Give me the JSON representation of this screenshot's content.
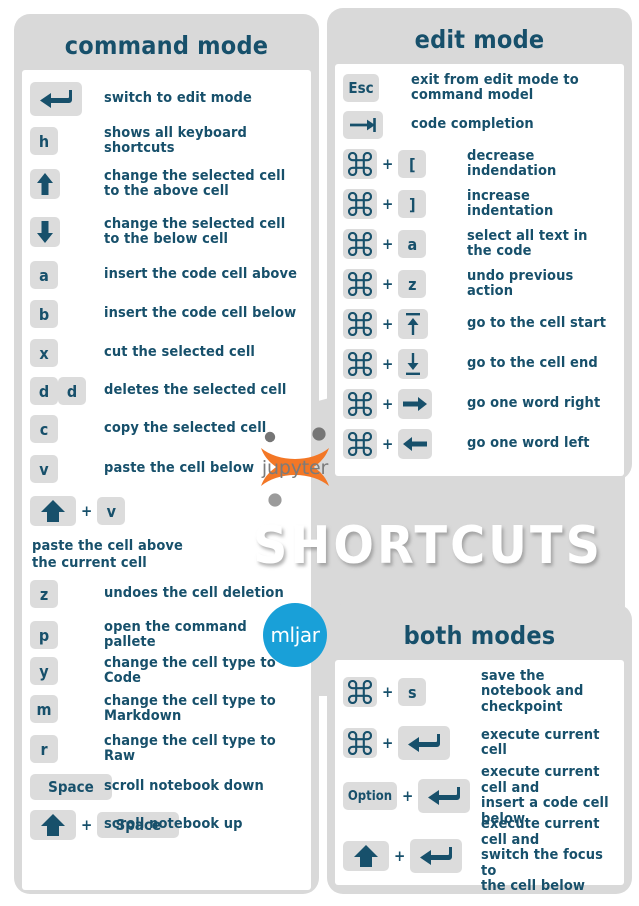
{
  "colors": {
    "panel_gray": "#d9d9d9",
    "key_gray": "#dcdcdc",
    "ink": "#17506b",
    "jupyter_orange": "#f37726",
    "jupyter_gray": "#7b7b7b",
    "mljar_blue": "#19a0d8",
    "white": "#ffffff"
  },
  "wordmark": {
    "text": "SHORTCUTS"
  },
  "logos": {
    "jupyter": {
      "name": "jupyter-logo",
      "label": "jupyter"
    },
    "mljar": {
      "name": "mljar-logo",
      "label": "mljar"
    }
  },
  "panels": {
    "command": {
      "title": "command mode",
      "rows": [
        {
          "keys": [
            {
              "type": "enter",
              "label": "↵",
              "icon": "enter-key-icon"
            }
          ],
          "desc": "switch to edit mode"
        },
        {
          "keys": [
            {
              "type": "char",
              "label": "h"
            }
          ],
          "desc": "shows all keyboard shortcuts"
        },
        {
          "keys": [
            {
              "type": "arrow-up-solid",
              "label": "⬆",
              "icon": "arrow-up-icon"
            }
          ],
          "desc": "change the selected cell to the above cell"
        },
        {
          "keys": [
            {
              "type": "arrow-down-solid",
              "label": "⬇",
              "icon": "arrow-down-icon"
            }
          ],
          "desc": "change the selected cell to the below cell"
        },
        {
          "keys": [
            {
              "type": "char",
              "label": "a"
            }
          ],
          "desc": "insert the code cell above"
        },
        {
          "keys": [
            {
              "type": "char",
              "label": "b"
            }
          ],
          "desc": "insert the code cell below"
        },
        {
          "keys": [
            {
              "type": "char",
              "label": "x"
            }
          ],
          "desc": "cut the selected cell"
        },
        {
          "keys": [
            {
              "type": "char",
              "label": "d"
            },
            {
              "type": "char",
              "label": "d"
            }
          ],
          "desc": "deletes the selected cell"
        },
        {
          "keys": [
            {
              "type": "char",
              "label": "c"
            }
          ],
          "desc": "copy the selected cell"
        },
        {
          "keys": [
            {
              "type": "char",
              "label": "v"
            }
          ],
          "desc": "paste the cell below"
        },
        {
          "keys": [
            {
              "type": "shift",
              "label": "⬆",
              "icon": "shift-key-icon"
            },
            {
              "type": "plus",
              "label": "+"
            },
            {
              "type": "char",
              "label": "v"
            }
          ],
          "desc": "paste the cell above\nthe current cell",
          "desc_below": true
        },
        {
          "keys": [
            {
              "type": "char",
              "label": "z"
            }
          ],
          "desc": "undoes the cell deletion"
        },
        {
          "keys": [
            {
              "type": "char",
              "label": "p"
            }
          ],
          "desc": "open the command pallete"
        },
        {
          "keys": [
            {
              "type": "char",
              "label": "y"
            }
          ],
          "desc": "change the cell type to Code"
        },
        {
          "keys": [
            {
              "type": "char",
              "label": "m"
            }
          ],
          "desc": "change the cell type to Markdown"
        },
        {
          "keys": [
            {
              "type": "char",
              "label": "r"
            }
          ],
          "desc": "change the cell type to Raw"
        },
        {
          "keys": [
            {
              "type": "space",
              "label": "Space"
            }
          ],
          "desc": "scroll notebook down"
        },
        {
          "keys": [
            {
              "type": "shift",
              "label": "⬆",
              "icon": "shift-key-icon"
            },
            {
              "type": "plus",
              "label": "+"
            },
            {
              "type": "space",
              "label": "Space"
            }
          ],
          "desc": "scroll notebook up"
        }
      ]
    },
    "edit": {
      "title": "edit mode",
      "rows": [
        {
          "keys": [
            {
              "type": "esc",
              "label": "Esc"
            }
          ],
          "desc": "exit from edit mode to command model"
        },
        {
          "keys": [
            {
              "type": "tab",
              "label": "→|",
              "icon": "tab-key-icon"
            }
          ],
          "desc": "code completion"
        },
        {
          "keys": [
            {
              "type": "cmd",
              "label": "⌘",
              "icon": "command-key-icon"
            },
            {
              "type": "plus",
              "label": "+"
            },
            {
              "type": "char",
              "label": "["
            }
          ],
          "desc": "decrease indendation"
        },
        {
          "keys": [
            {
              "type": "cmd",
              "label": "⌘",
              "icon": "command-key-icon"
            },
            {
              "type": "plus",
              "label": "+"
            },
            {
              "type": "char",
              "label": "]"
            }
          ],
          "desc": "increase indentation"
        },
        {
          "keys": [
            {
              "type": "cmd",
              "label": "⌘",
              "icon": "command-key-icon"
            },
            {
              "type": "plus",
              "label": "+"
            },
            {
              "type": "char",
              "label": "a"
            }
          ],
          "desc": "select all text in the code"
        },
        {
          "keys": [
            {
              "type": "cmd",
              "label": "⌘",
              "icon": "command-key-icon"
            },
            {
              "type": "plus",
              "label": "+"
            },
            {
              "type": "char",
              "label": "z"
            }
          ],
          "desc": "undo previous action"
        },
        {
          "keys": [
            {
              "type": "cmd",
              "label": "⌘",
              "icon": "command-key-icon"
            },
            {
              "type": "plus",
              "label": "+"
            },
            {
              "type": "arrow-up-bar",
              "label": "↥",
              "icon": "arrow-up-to-line-icon"
            }
          ],
          "desc": "go to the cell start"
        },
        {
          "keys": [
            {
              "type": "cmd",
              "label": "⌘",
              "icon": "command-key-icon"
            },
            {
              "type": "plus",
              "label": "+"
            },
            {
              "type": "arrow-down-bar",
              "label": "↧",
              "icon": "arrow-down-to-line-icon"
            }
          ],
          "desc": "go to the cell end"
        },
        {
          "keys": [
            {
              "type": "cmd",
              "label": "⌘",
              "icon": "command-key-icon"
            },
            {
              "type": "plus",
              "label": "+"
            },
            {
              "type": "arrow-right-solid",
              "label": "➡",
              "icon": "arrow-right-icon"
            }
          ],
          "desc": "go one word right"
        },
        {
          "keys": [
            {
              "type": "cmd",
              "label": "⌘",
              "icon": "command-key-icon"
            },
            {
              "type": "plus",
              "label": "+"
            },
            {
              "type": "arrow-left-solid",
              "label": "⬅",
              "icon": "arrow-left-icon"
            }
          ],
          "desc": "go one word left"
        }
      ]
    },
    "both": {
      "title": "both modes",
      "rows": [
        {
          "keys": [
            {
              "type": "cmd",
              "label": "⌘",
              "icon": "command-key-icon"
            },
            {
              "type": "plus",
              "label": "+"
            },
            {
              "type": "char",
              "label": "s"
            }
          ],
          "desc": "save the notebook and\ncheckpoint"
        },
        {
          "keys": [
            {
              "type": "cmd",
              "label": "⌘",
              "icon": "command-key-icon"
            },
            {
              "type": "plus",
              "label": "+"
            },
            {
              "type": "enter",
              "label": "↵",
              "icon": "enter-key-icon"
            }
          ],
          "desc": "execute current cell"
        },
        {
          "keys": [
            {
              "type": "opt",
              "label": "Option"
            },
            {
              "type": "plus",
              "label": "+"
            },
            {
              "type": "enter",
              "label": "↵",
              "icon": "enter-key-icon"
            }
          ],
          "desc": "execute current cell and\ninsert a code cell below"
        },
        {
          "keys": [
            {
              "type": "shift",
              "label": "⬆",
              "icon": "shift-key-icon"
            },
            {
              "type": "plus",
              "label": "+"
            },
            {
              "type": "enter",
              "label": "↵",
              "icon": "enter-key-icon"
            }
          ],
          "desc": "execute current cell and\nswitch the focus to\nthe cell below"
        }
      ]
    }
  }
}
